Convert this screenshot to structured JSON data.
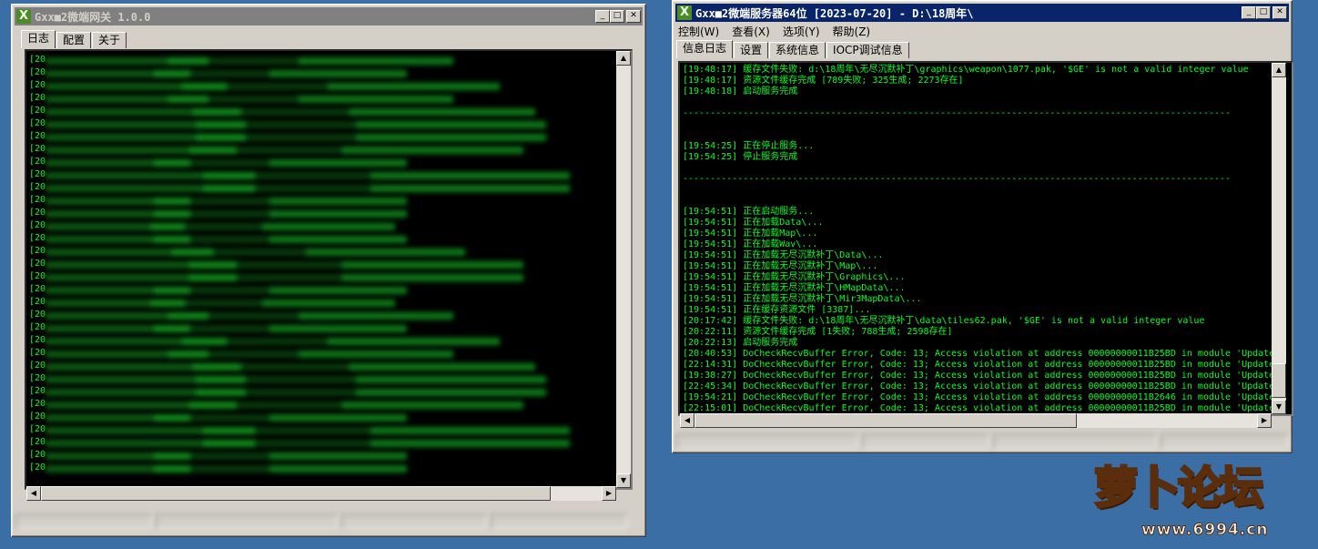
{
  "gateway": {
    "title": "Gxx■2微端网关 1.0.0",
    "tabs": [
      "日志",
      "配置",
      "关于"
    ],
    "log_prefix": "[20",
    "line_count": 33,
    "status_cells": [
      "",
      "",
      "",
      ""
    ]
  },
  "server": {
    "title": "Gxx■2微端服务器64位 [2023-07-20] - D:\\18周年\\",
    "menu": [
      "控制(W)",
      "查看(X)",
      "选项(Y)",
      "帮助(Z)"
    ],
    "tabs": [
      "信息日志",
      "设置",
      "系统信息",
      "IOCP调试信息"
    ],
    "log": [
      "[19:48:17] 缓存文件失败: d:\\18周年\\无尽沉默补丁\\graphics\\weapon\\1077.pak, '$GE' is not a valid integer value",
      "[19:48:17] 资源文件缓存完成 [789失败; 325生成; 2273存在]",
      "[19:48:18] 启动服务完成",
      "",
      "----------------------------------------------------------------------------------------------------",
      "",
      "",
      "[19:54:25] 正在停止服务...",
      "[19:54:25] 停止服务完成",
      "",
      "----------------------------------------------------------------------------------------------------",
      "",
      "",
      "[19:54:51] 正在启动服务...",
      "[19:54:51] 正在加载Data\\...",
      "[19:54:51] 正在加载Map\\...",
      "[19:54:51] 正在加载Wav\\...",
      "[19:54:51] 正在加载无尽沉默补丁\\Data\\...",
      "[19:54:51] 正在加载无尽沉默补丁\\Map\\...",
      "[19:54:51] 正在加载无尽沉默补丁\\Graphics\\...",
      "[19:54:51] 正在加载无尽沉默补丁\\HMapData\\...",
      "[19:54:51] 正在加载无尽沉默补丁\\Mir3MapData\\...",
      "[19:54:51] 正在缓存资源文件 [3387]...",
      "[20:17:42] 缓存文件失败: d:\\18周年\\无尽沉默补丁\\data\\tiles62.pak, '$GE' is not a valid integer value",
      "[20:22:11] 资源文件缓存完成 [1失败; 788生成; 2598存在]",
      "[20:22:13] 启动服务完成",
      "[20:40:53] DoCheckRecvBuffer Error, Code: 13; Access violation at address 00000000011B25BD in module 'Update",
      "[22:14:31] DoCheckRecvBuffer Error, Code: 13; Access violation at address 00000000011B25BD in module 'Update",
      "[19:38:27] DoCheckRecvBuffer Error, Code: 13; Access violation at address 00000000011B25BD in module 'Update",
      "[22:45:34] DoCheckRecvBuffer Error, Code: 13; Access violation at address 00000000011B25BD in module 'Update",
      "[19:54:21] DoCheckRecvBuffer Error, Code: 13; Access violation at address 00000000011B2646 in module 'Update",
      "[22:15:01] DoCheckRecvBuffer Error, Code: 13; Access violation at address 00000000011B25BD in module 'Update"
    ]
  },
  "watermark": {
    "logo": "萝卜论坛",
    "url": "www.6994.cn"
  },
  "colors": {
    "desktop": "#3a6ea5",
    "log_text": "#00ff20",
    "active_title": "#0a246a",
    "inactive_title": "#808080"
  },
  "icons": {
    "app": "x-logo-icon",
    "minimize": "minimize-icon",
    "maximize": "maximize-icon",
    "close": "close-icon",
    "up": "arrow-up-icon",
    "down": "arrow-down-icon",
    "left": "arrow-left-icon",
    "right": "arrow-right-icon"
  }
}
